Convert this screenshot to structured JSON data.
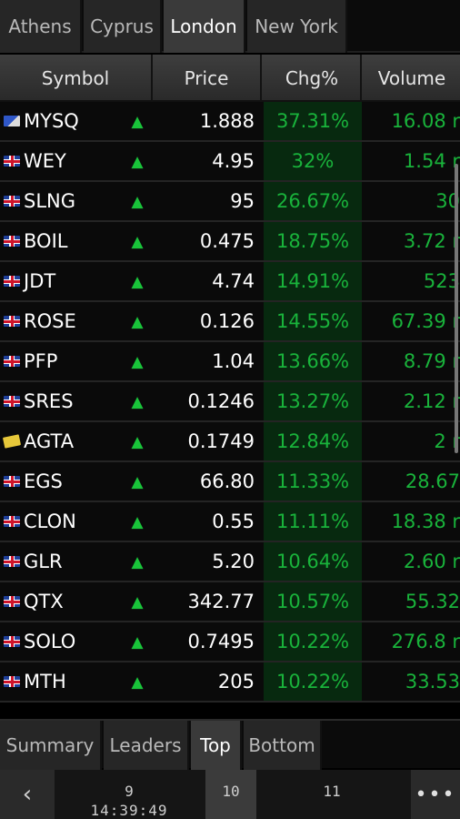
{
  "top_tabs": [
    "Athens",
    "Cyprus",
    "London",
    "New York"
  ],
  "active_top_tab": "London",
  "columns": {
    "symbol": "Symbol",
    "price": "Price",
    "chg": "Chg%",
    "volume": "Volume"
  },
  "rows": [
    {
      "flag": "alt",
      "symbol": "MYSQ",
      "price": "1.888",
      "chg": "37.31%",
      "volume": "16.08 r"
    },
    {
      "flag": "uk",
      "symbol": "WEY",
      "price": "4.95",
      "chg": "32%",
      "volume": "1.54 r"
    },
    {
      "flag": "uk",
      "symbol": "SLNG",
      "price": "95",
      "chg": "26.67%",
      "volume": "30"
    },
    {
      "flag": "uk",
      "symbol": "BOIL",
      "price": "0.475",
      "chg": "18.75%",
      "volume": "3.72 r"
    },
    {
      "flag": "uk",
      "symbol": "JDT",
      "price": "4.74",
      "chg": "14.91%",
      "volume": "523"
    },
    {
      "flag": "uk",
      "symbol": "ROSE",
      "price": "0.126",
      "chg": "14.55%",
      "volume": "67.39 r"
    },
    {
      "flag": "uk",
      "symbol": "PFP",
      "price": "1.04",
      "chg": "13.66%",
      "volume": "8.79 r"
    },
    {
      "flag": "uk",
      "symbol": "SRES",
      "price": "0.1246",
      "chg": "13.27%",
      "volume": "2.12 r"
    },
    {
      "flag": "gold",
      "symbol": "AGTA",
      "price": "0.1749",
      "chg": "12.84%",
      "volume": "2 r"
    },
    {
      "flag": "uk",
      "symbol": "EGS",
      "price": "66.80",
      "chg": "11.33%",
      "volume": "28.67"
    },
    {
      "flag": "uk",
      "symbol": "CLON",
      "price": "0.55",
      "chg": "11.11%",
      "volume": "18.38 r"
    },
    {
      "flag": "uk",
      "symbol": "GLR",
      "price": "5.20",
      "chg": "10.64%",
      "volume": "2.60 r"
    },
    {
      "flag": "uk",
      "symbol": "QTX",
      "price": "342.77",
      "chg": "10.57%",
      "volume": "55.32"
    },
    {
      "flag": "uk",
      "symbol": "SOLO",
      "price": "0.7495",
      "chg": "10.22%",
      "volume": "276.8 r"
    },
    {
      "flag": "uk",
      "symbol": "MTH",
      "price": "205",
      "chg": "10.22%",
      "volume": "33.53"
    }
  ],
  "bottom_tabs": [
    "Summary",
    "Leaders",
    "Top",
    "Bottom"
  ],
  "active_bottom_tab": "Top",
  "pager": {
    "back_icon": "‹",
    "pages": [
      {
        "num": "9",
        "time": "14:39:49"
      },
      {
        "num": "10",
        "time": ""
      },
      {
        "num": "11",
        "time": ""
      }
    ],
    "active_page": "10",
    "more_icon": "•••"
  },
  "colors": {
    "up": "#19c43a",
    "chg_bg": "#07290f"
  }
}
